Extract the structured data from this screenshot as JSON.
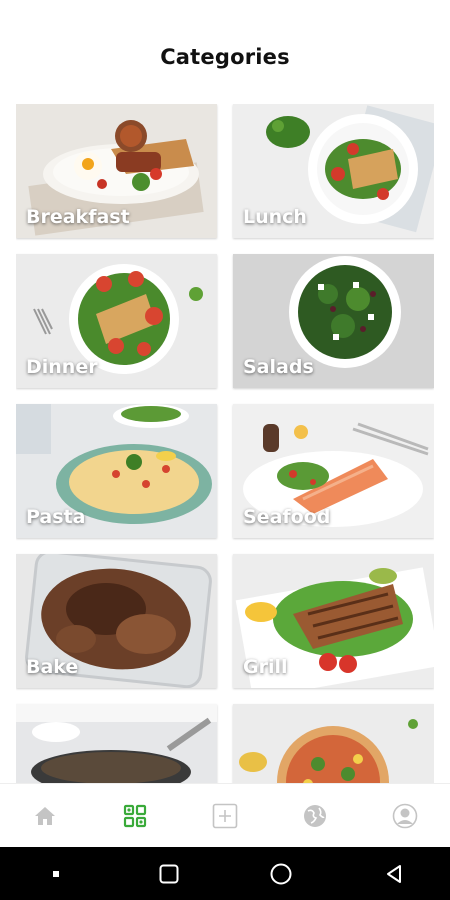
{
  "header": {
    "title": "Categories"
  },
  "categories": [
    {
      "label": "Breakfast"
    },
    {
      "label": "Lunch"
    },
    {
      "label": "Dinner"
    },
    {
      "label": "Salads"
    },
    {
      "label": "Pasta"
    },
    {
      "label": "Seafood"
    },
    {
      "label": "Bake"
    },
    {
      "label": "Grill"
    },
    {
      "label": ""
    },
    {
      "label": ""
    }
  ],
  "bottom_nav": {
    "items": [
      {
        "icon": "home-icon",
        "active": false
      },
      {
        "icon": "categories-grid-icon",
        "active": true
      },
      {
        "icon": "add-icon",
        "active": false
      },
      {
        "icon": "globe-icon",
        "active": false
      },
      {
        "icon": "profile-icon",
        "active": false
      }
    ],
    "active_color": "#3aaa3a",
    "inactive_color": "#c4c4c4"
  },
  "system_nav": {
    "items": [
      {
        "icon": "dot-icon"
      },
      {
        "icon": "recent-apps-icon"
      },
      {
        "icon": "home-circle-icon"
      },
      {
        "icon": "back-icon"
      }
    ]
  }
}
